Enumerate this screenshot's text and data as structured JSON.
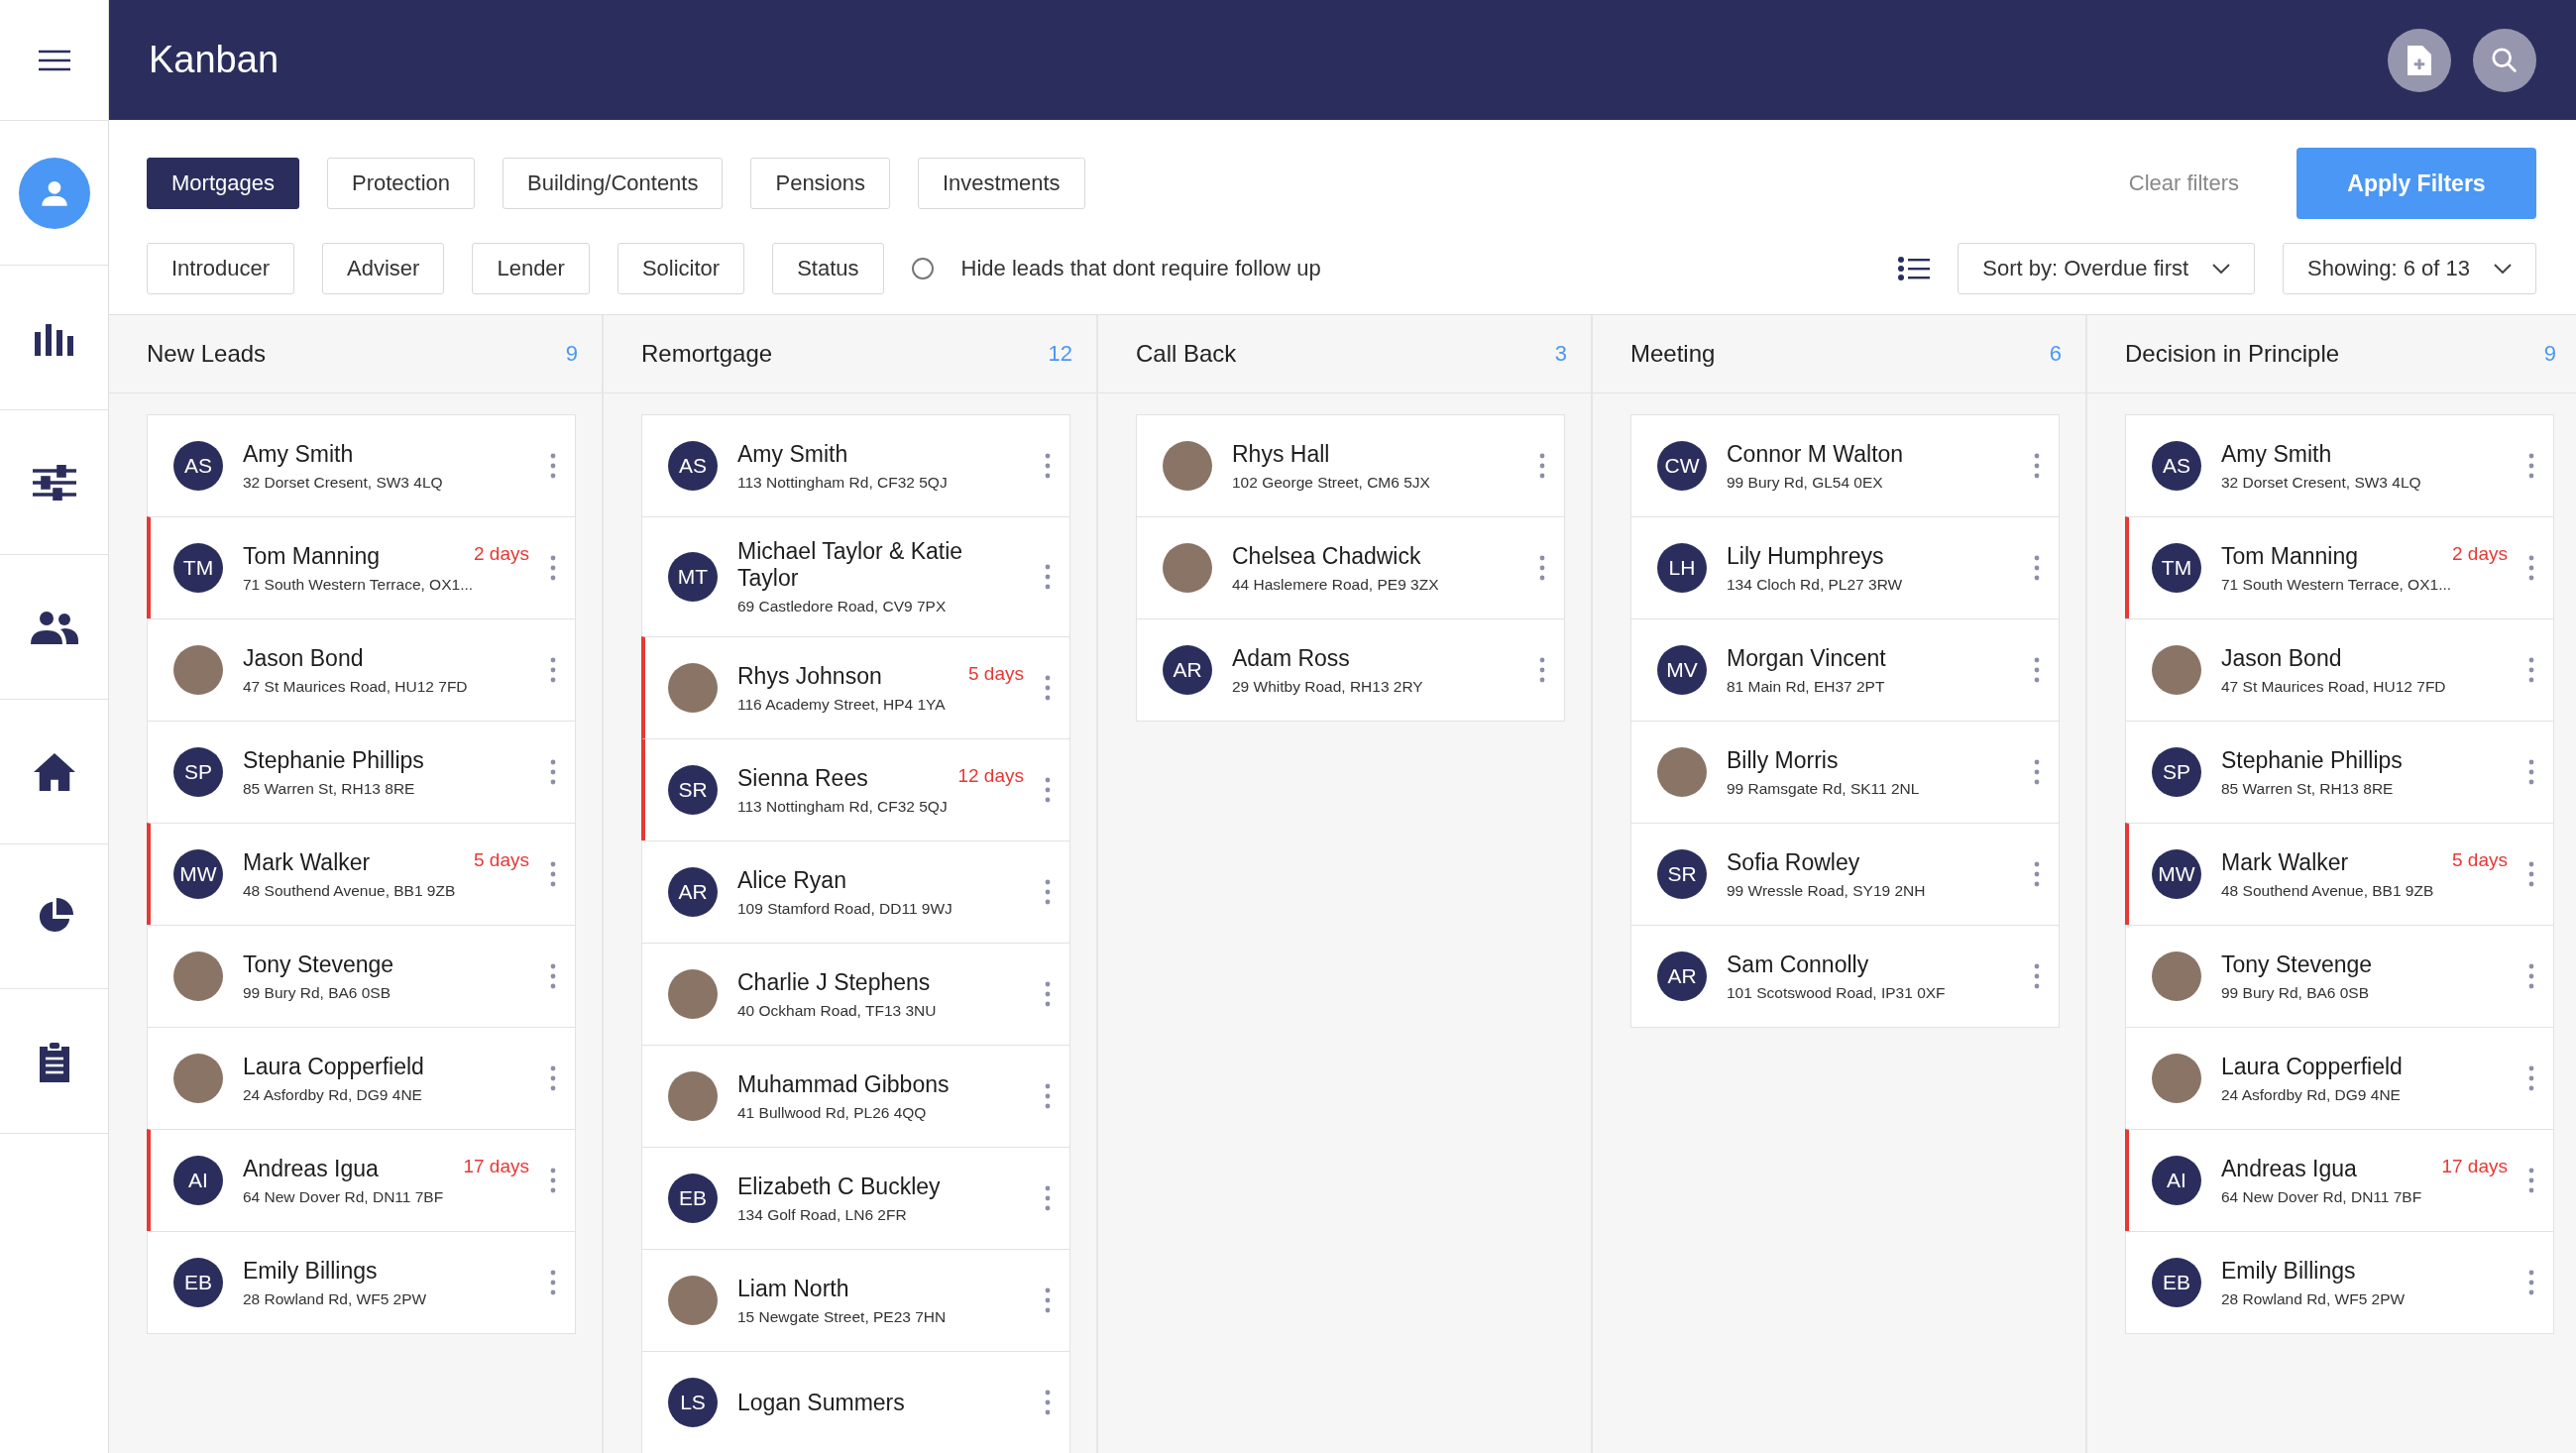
{
  "header": {
    "title": "Kanban"
  },
  "sidebar": {
    "items": [
      {
        "kind": "profile"
      },
      {
        "kind": "chart"
      },
      {
        "kind": "sliders"
      },
      {
        "kind": "people"
      },
      {
        "kind": "home"
      },
      {
        "kind": "pie"
      },
      {
        "kind": "clipboard"
      }
    ]
  },
  "product_tabs": [
    {
      "label": "Mortgages",
      "selected": true
    },
    {
      "label": "Protection",
      "selected": false
    },
    {
      "label": "Building/Contents",
      "selected": false
    },
    {
      "label": "Pensions",
      "selected": false
    },
    {
      "label": "Investments",
      "selected": false
    }
  ],
  "filters": [
    "Introducer",
    "Adviser",
    "Lender",
    "Solicitor",
    "Status"
  ],
  "follow_up_option": {
    "label": "Hide leads that dont require follow up",
    "checked": false
  },
  "clear_filters": "Clear filters",
  "apply_filters": "Apply Filters",
  "sort": "Sort by: Overdue first",
  "showing": "Showing: 6 of 13",
  "columns": [
    {
      "title": "New Leads",
      "count": "9",
      "cards": [
        {
          "kind": "initials",
          "initials": "AS",
          "name": "Amy Smith",
          "address": "32 Dorset Cresent, SW3 4LQ",
          "overdue": false
        },
        {
          "kind": "initials",
          "initials": "TM",
          "name": "Tom Manning",
          "address": "71 South Western Terrace, OX1...",
          "overdue": true,
          "due": "2 days"
        },
        {
          "kind": "photo",
          "name": "Jason Bond",
          "address": "47 St Maurices Road, HU12 7FD",
          "overdue": false
        },
        {
          "kind": "initials",
          "initials": "SP",
          "name": "Stephanie Phillips",
          "address": "85 Warren St, RH13 8RE",
          "overdue": false
        },
        {
          "kind": "initials",
          "initials": "MW",
          "name": "Mark Walker",
          "address": "48 Southend Avenue, BB1 9ZB",
          "overdue": true,
          "due": "5 days"
        },
        {
          "kind": "photo",
          "name": "Tony Stevenge",
          "address": "99 Bury Rd, BA6 0SB",
          "overdue": false
        },
        {
          "kind": "photo",
          "name": "Laura Copperfield",
          "address": "24 Asfordby Rd, DG9 4NE",
          "overdue": false
        },
        {
          "kind": "initials",
          "initials": "AI",
          "name": "Andreas Igua",
          "address": "64 New Dover Rd, DN11 7BF",
          "overdue": true,
          "due": "17 days"
        },
        {
          "kind": "initials",
          "initials": "EB",
          "name": "Emily Billings",
          "address": "28 Rowland Rd, WF5 2PW",
          "overdue": false
        }
      ]
    },
    {
      "title": "Remortgage",
      "count": "12",
      "cards": [
        {
          "kind": "initials",
          "initials": "AS",
          "name": "Amy Smith",
          "address": "113 Nottingham Rd, CF32 5QJ",
          "overdue": false
        },
        {
          "kind": "initials",
          "initials": "MT",
          "name": "Michael Taylor & Katie Taylor",
          "address": "69 Castledore Road, CV9 7PX",
          "overdue": false
        },
        {
          "kind": "photo",
          "name": "Rhys Johnson",
          "address": "116 Academy Street, HP4 1YA",
          "overdue": true,
          "due": "5 days"
        },
        {
          "kind": "initials",
          "initials": "SR",
          "name": "Sienna Rees",
          "address": "113 Nottingham Rd, CF32 5QJ",
          "overdue": true,
          "due": "12 days"
        },
        {
          "kind": "initials",
          "initials": "AR",
          "name": "Alice Ryan",
          "address": "109 Stamford Road, DD11 9WJ",
          "overdue": false
        },
        {
          "kind": "photo",
          "name": "Charlie J Stephens",
          "address": "40 Ockham Road, TF13 3NU",
          "overdue": false
        },
        {
          "kind": "photo",
          "name": "Muhammad Gibbons",
          "address": "41 Bullwood Rd, PL26 4QQ",
          "overdue": false
        },
        {
          "kind": "initials",
          "initials": "EB",
          "name": "Elizabeth C Buckley",
          "address": "134 Golf Road, LN6 2FR",
          "overdue": false
        },
        {
          "kind": "photo",
          "name": "Liam North",
          "address": "15 Newgate Street, PE23 7HN",
          "overdue": false
        },
        {
          "kind": "initials",
          "initials": "LS",
          "name": "Logan Summers",
          "overdue": false
        }
      ]
    },
    {
      "title": "Call Back",
      "count": "3",
      "cards": [
        {
          "kind": "photo",
          "name": "Rhys Hall",
          "address": "102 George Street, CM6 5JX",
          "overdue": false
        },
        {
          "kind": "photo",
          "name": "Chelsea Chadwick",
          "address": "44 Haslemere Road, PE9 3ZX",
          "overdue": false
        },
        {
          "kind": "initials",
          "initials": "AR",
          "name": "Adam Ross",
          "address": "29 Whitby Road, RH13 2RY",
          "overdue": false
        }
      ]
    },
    {
      "title": "Meeting",
      "count": "6",
      "cards": [
        {
          "kind": "initials",
          "initials": "CW",
          "name": "Connor M Walton",
          "address": "99 Bury Rd, GL54 0EX",
          "overdue": false
        },
        {
          "kind": "initials",
          "initials": "LH",
          "name": "Lily Humphreys",
          "address": "134 Cloch Rd, PL27 3RW",
          "overdue": false
        },
        {
          "kind": "initials",
          "initials": "MV",
          "name": "Morgan Vincent",
          "address": "81 Main Rd, EH37 2PT",
          "overdue": false
        },
        {
          "kind": "photo",
          "name": "Billy Morris",
          "address": "99 Ramsgate Rd, SK11 2NL",
          "overdue": false
        },
        {
          "kind": "initials",
          "initials": "SR",
          "name": "Sofia Rowley",
          "address": "99 Wressle Road, SY19 2NH",
          "overdue": false
        },
        {
          "kind": "initials",
          "initials": "AR",
          "name": "Sam Connolly",
          "address": "101 Scotswood Road, IP31 0XF",
          "overdue": false
        }
      ]
    },
    {
      "title": "Decision in Principle",
      "count": "9",
      "cards": [
        {
          "kind": "initials",
          "initials": "AS",
          "name": "Amy Smith",
          "address": "32 Dorset Cresent, SW3 4LQ",
          "overdue": false
        },
        {
          "kind": "initials",
          "initials": "TM",
          "name": "Tom Manning",
          "address": "71 South Western Terrace, OX1...",
          "overdue": true,
          "due": "2 days"
        },
        {
          "kind": "photo",
          "name": "Jason Bond",
          "address": "47 St Maurices Road, HU12 7FD",
          "overdue": false
        },
        {
          "kind": "initials",
          "initials": "SP",
          "name": "Stephanie Phillips",
          "address": "85 Warren St, RH13 8RE",
          "overdue": false
        },
        {
          "kind": "initials",
          "initials": "MW",
          "name": "Mark Walker",
          "address": "48 Southend Avenue, BB1 9ZB",
          "overdue": true,
          "due": "5 days"
        },
        {
          "kind": "photo",
          "name": "Tony Stevenge",
          "address": "99 Bury Rd, BA6 0SB",
          "overdue": false
        },
        {
          "kind": "photo",
          "name": "Laura Copperfield",
          "address": "24 Asfordby Rd, DG9 4NE",
          "overdue": false
        },
        {
          "kind": "initials",
          "initials": "AI",
          "name": "Andreas Igua",
          "address": "64 New Dover Rd, DN11 7BF",
          "overdue": true,
          "due": "17 days"
        },
        {
          "kind": "initials",
          "initials": "EB",
          "name": "Emily Billings",
          "address": "28 Rowland Rd, WF5 2PW",
          "overdue": false
        }
      ]
    }
  ]
}
